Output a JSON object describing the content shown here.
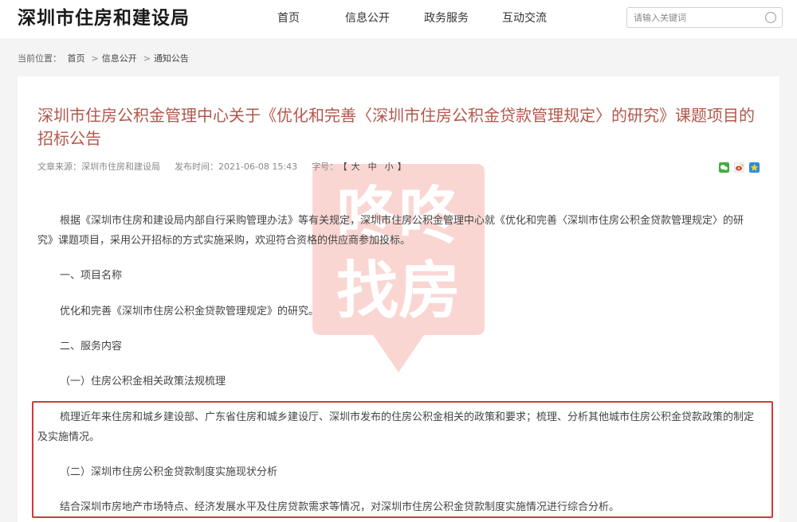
{
  "header": {
    "site_title": "深圳市住房和建设局",
    "nav": [
      {
        "label": "首页"
      },
      {
        "label": "信息公开"
      },
      {
        "label": "政务服务"
      },
      {
        "label": "互动交流"
      }
    ],
    "search": {
      "placeholder": "请输入关键词",
      "icon": "search-icon"
    }
  },
  "breadcrumb": {
    "prefix": "当前位置：",
    "items": [
      "首页",
      "信息公开",
      "通知公告"
    ],
    "separator": ">"
  },
  "article": {
    "title": "深圳市住房公积金管理中心关于《优化和完善〈深圳市住房公积金贷款管理规定〉的研究》课题项目的招标公告",
    "meta": {
      "source_label": "文章来源：",
      "source": "深圳市住房和建设局",
      "time_label": "发布时间：",
      "time": "2021-06-08 15:43",
      "fontsize_label": "字号：",
      "fontsize_open": "【",
      "fontsize_options": [
        "大",
        "中",
        "小"
      ],
      "fontsize_close": "】"
    },
    "share_icons": [
      "wechat-share-icon",
      "weibo-share-icon",
      "qzone-share-icon"
    ],
    "paragraphs": [
      "根据《深圳市住房和建设局内部自行采购管理办法》等有关规定，深圳市住房公积金管理中心就《优化和完善〈深圳市住房公积金贷款管理规定〉的研",
      "究》课题项目，采用公开招标的方式实施采购，欢迎符合资格的供应商参加投标。",
      "一、项目名称",
      "优化和完善《深圳市住房公积金贷款管理规定》的研究。",
      "二、服务内容",
      "（一）住房公积金相关政策法规梳理",
      "梳理近年来住房和城乡建设部、广东省住房和城乡建设厅、深圳市发布的住房公积金相关的政策和要求；梳理、分析其他城市住房公积金贷款政策的制定",
      "及实施情况。",
      "（二）深圳市住房公积金贷款制度实施现状分析",
      "结合深圳市房地产市场特点、经济发展水平及住房贷款需求等情况，对深圳市住房公积金贷款制度实施情况进行综合分析。"
    ]
  },
  "watermark": {
    "line1": "咚咚",
    "line2": "找房"
  },
  "colors": {
    "title": "#b1584c",
    "highlight_border": "#d23a35",
    "background": "#f4f4f4"
  }
}
